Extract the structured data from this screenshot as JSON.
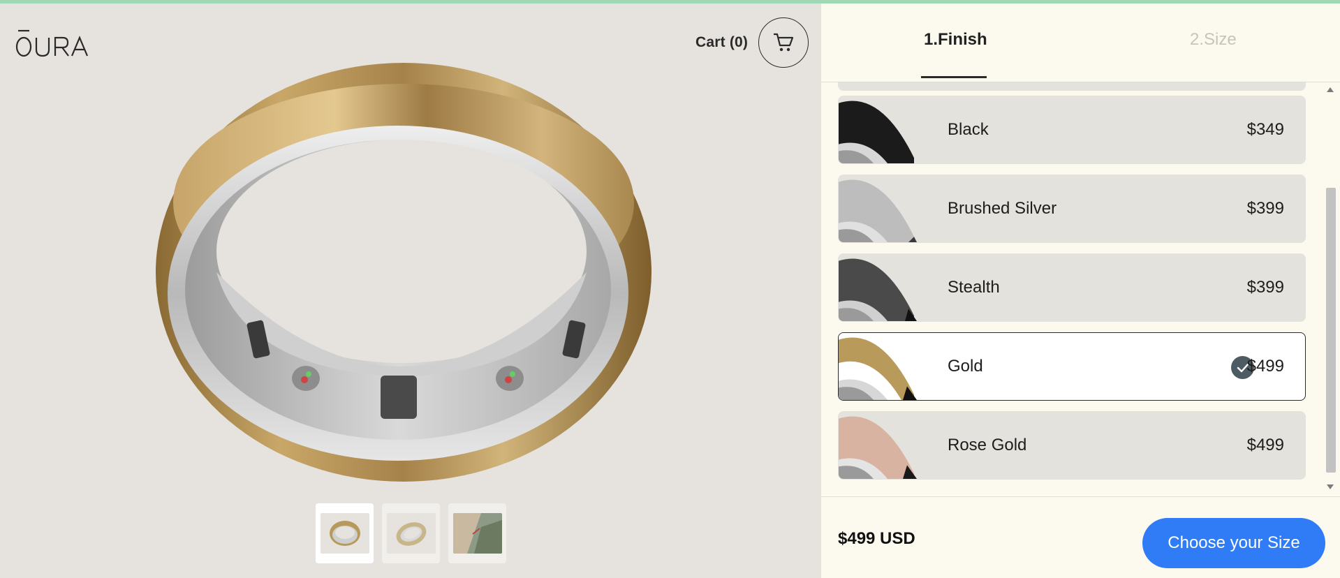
{
  "brand": {
    "logo_text": "ŌURA"
  },
  "header": {
    "cart_label": "Cart (0)",
    "cart_icon": "cart-icon"
  },
  "gallery": {
    "thumbnails": [
      {
        "label": "ring-front-view",
        "active": true
      },
      {
        "label": "ring-side-view",
        "active": false
      },
      {
        "label": "lifestyle-photo",
        "active": false
      }
    ]
  },
  "steps": [
    {
      "label": "1.Finish",
      "active": true
    },
    {
      "label": "2.Size",
      "active": false
    }
  ],
  "finishes": [
    {
      "name": "Black",
      "price": "$349",
      "selected": false,
      "color": "#1b1b1b"
    },
    {
      "name": "Brushed Silver",
      "price": "$399",
      "selected": false,
      "color": "#bdbdbd"
    },
    {
      "name": "Stealth",
      "price": "$399",
      "selected": false,
      "color": "#4a4a4a"
    },
    {
      "name": "Gold",
      "price": "$499",
      "selected": true,
      "color": "#b89a5b"
    },
    {
      "name": "Rose Gold",
      "price": "$499",
      "selected": false,
      "color": "#d9b3a1"
    }
  ],
  "footer": {
    "total": "$499 USD",
    "cta_label": "Choose your Size"
  },
  "colors": {
    "accent": "#2f7cf6",
    "panel_bg": "#fcf9ef",
    "card_bg": "#e3e2dc",
    "check_bg": "#4d5b63"
  }
}
